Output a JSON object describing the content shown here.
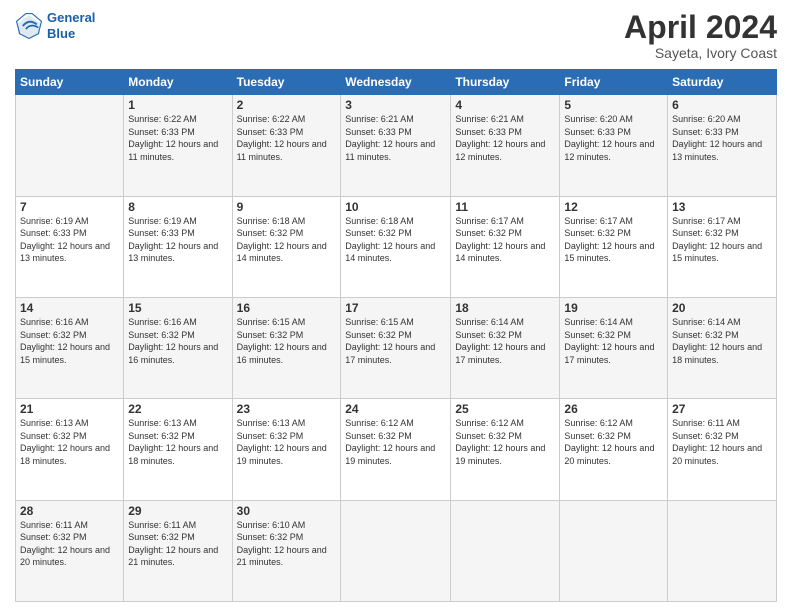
{
  "header": {
    "logo_line1": "General",
    "logo_line2": "Blue",
    "title": "April 2024",
    "subtitle": "Sayeta, Ivory Coast"
  },
  "weekdays": [
    "Sunday",
    "Monday",
    "Tuesday",
    "Wednesday",
    "Thursday",
    "Friday",
    "Saturday"
  ],
  "weeks": [
    [
      {
        "day": "",
        "sunrise": "",
        "sunset": "",
        "daylight": ""
      },
      {
        "day": "1",
        "sunrise": "Sunrise: 6:22 AM",
        "sunset": "Sunset: 6:33 PM",
        "daylight": "Daylight: 12 hours and 11 minutes."
      },
      {
        "day": "2",
        "sunrise": "Sunrise: 6:22 AM",
        "sunset": "Sunset: 6:33 PM",
        "daylight": "Daylight: 12 hours and 11 minutes."
      },
      {
        "day": "3",
        "sunrise": "Sunrise: 6:21 AM",
        "sunset": "Sunset: 6:33 PM",
        "daylight": "Daylight: 12 hours and 11 minutes."
      },
      {
        "day": "4",
        "sunrise": "Sunrise: 6:21 AM",
        "sunset": "Sunset: 6:33 PM",
        "daylight": "Daylight: 12 hours and 12 minutes."
      },
      {
        "day": "5",
        "sunrise": "Sunrise: 6:20 AM",
        "sunset": "Sunset: 6:33 PM",
        "daylight": "Daylight: 12 hours and 12 minutes."
      },
      {
        "day": "6",
        "sunrise": "Sunrise: 6:20 AM",
        "sunset": "Sunset: 6:33 PM",
        "daylight": "Daylight: 12 hours and 13 minutes."
      }
    ],
    [
      {
        "day": "7",
        "sunrise": "Sunrise: 6:19 AM",
        "sunset": "Sunset: 6:33 PM",
        "daylight": "Daylight: 12 hours and 13 minutes."
      },
      {
        "day": "8",
        "sunrise": "Sunrise: 6:19 AM",
        "sunset": "Sunset: 6:33 PM",
        "daylight": "Daylight: 12 hours and 13 minutes."
      },
      {
        "day": "9",
        "sunrise": "Sunrise: 6:18 AM",
        "sunset": "Sunset: 6:32 PM",
        "daylight": "Daylight: 12 hours and 14 minutes."
      },
      {
        "day": "10",
        "sunrise": "Sunrise: 6:18 AM",
        "sunset": "Sunset: 6:32 PM",
        "daylight": "Daylight: 12 hours and 14 minutes."
      },
      {
        "day": "11",
        "sunrise": "Sunrise: 6:17 AM",
        "sunset": "Sunset: 6:32 PM",
        "daylight": "Daylight: 12 hours and 14 minutes."
      },
      {
        "day": "12",
        "sunrise": "Sunrise: 6:17 AM",
        "sunset": "Sunset: 6:32 PM",
        "daylight": "Daylight: 12 hours and 15 minutes."
      },
      {
        "day": "13",
        "sunrise": "Sunrise: 6:17 AM",
        "sunset": "Sunset: 6:32 PM",
        "daylight": "Daylight: 12 hours and 15 minutes."
      }
    ],
    [
      {
        "day": "14",
        "sunrise": "Sunrise: 6:16 AM",
        "sunset": "Sunset: 6:32 PM",
        "daylight": "Daylight: 12 hours and 15 minutes."
      },
      {
        "day": "15",
        "sunrise": "Sunrise: 6:16 AM",
        "sunset": "Sunset: 6:32 PM",
        "daylight": "Daylight: 12 hours and 16 minutes."
      },
      {
        "day": "16",
        "sunrise": "Sunrise: 6:15 AM",
        "sunset": "Sunset: 6:32 PM",
        "daylight": "Daylight: 12 hours and 16 minutes."
      },
      {
        "day": "17",
        "sunrise": "Sunrise: 6:15 AM",
        "sunset": "Sunset: 6:32 PM",
        "daylight": "Daylight: 12 hours and 17 minutes."
      },
      {
        "day": "18",
        "sunrise": "Sunrise: 6:14 AM",
        "sunset": "Sunset: 6:32 PM",
        "daylight": "Daylight: 12 hours and 17 minutes."
      },
      {
        "day": "19",
        "sunrise": "Sunrise: 6:14 AM",
        "sunset": "Sunset: 6:32 PM",
        "daylight": "Daylight: 12 hours and 17 minutes."
      },
      {
        "day": "20",
        "sunrise": "Sunrise: 6:14 AM",
        "sunset": "Sunset: 6:32 PM",
        "daylight": "Daylight: 12 hours and 18 minutes."
      }
    ],
    [
      {
        "day": "21",
        "sunrise": "Sunrise: 6:13 AM",
        "sunset": "Sunset: 6:32 PM",
        "daylight": "Daylight: 12 hours and 18 minutes."
      },
      {
        "day": "22",
        "sunrise": "Sunrise: 6:13 AM",
        "sunset": "Sunset: 6:32 PM",
        "daylight": "Daylight: 12 hours and 18 minutes."
      },
      {
        "day": "23",
        "sunrise": "Sunrise: 6:13 AM",
        "sunset": "Sunset: 6:32 PM",
        "daylight": "Daylight: 12 hours and 19 minutes."
      },
      {
        "day": "24",
        "sunrise": "Sunrise: 6:12 AM",
        "sunset": "Sunset: 6:32 PM",
        "daylight": "Daylight: 12 hours and 19 minutes."
      },
      {
        "day": "25",
        "sunrise": "Sunrise: 6:12 AM",
        "sunset": "Sunset: 6:32 PM",
        "daylight": "Daylight: 12 hours and 19 minutes."
      },
      {
        "day": "26",
        "sunrise": "Sunrise: 6:12 AM",
        "sunset": "Sunset: 6:32 PM",
        "daylight": "Daylight: 12 hours and 20 minutes."
      },
      {
        "day": "27",
        "sunrise": "Sunrise: 6:11 AM",
        "sunset": "Sunset: 6:32 PM",
        "daylight": "Daylight: 12 hours and 20 minutes."
      }
    ],
    [
      {
        "day": "28",
        "sunrise": "Sunrise: 6:11 AM",
        "sunset": "Sunset: 6:32 PM",
        "daylight": "Daylight: 12 hours and 20 minutes."
      },
      {
        "day": "29",
        "sunrise": "Sunrise: 6:11 AM",
        "sunset": "Sunset: 6:32 PM",
        "daylight": "Daylight: 12 hours and 21 minutes."
      },
      {
        "day": "30",
        "sunrise": "Sunrise: 6:10 AM",
        "sunset": "Sunset: 6:32 PM",
        "daylight": "Daylight: 12 hours and 21 minutes."
      },
      {
        "day": "",
        "sunrise": "",
        "sunset": "",
        "daylight": ""
      },
      {
        "day": "",
        "sunrise": "",
        "sunset": "",
        "daylight": ""
      },
      {
        "day": "",
        "sunrise": "",
        "sunset": "",
        "daylight": ""
      },
      {
        "day": "",
        "sunrise": "",
        "sunset": "",
        "daylight": ""
      }
    ]
  ]
}
